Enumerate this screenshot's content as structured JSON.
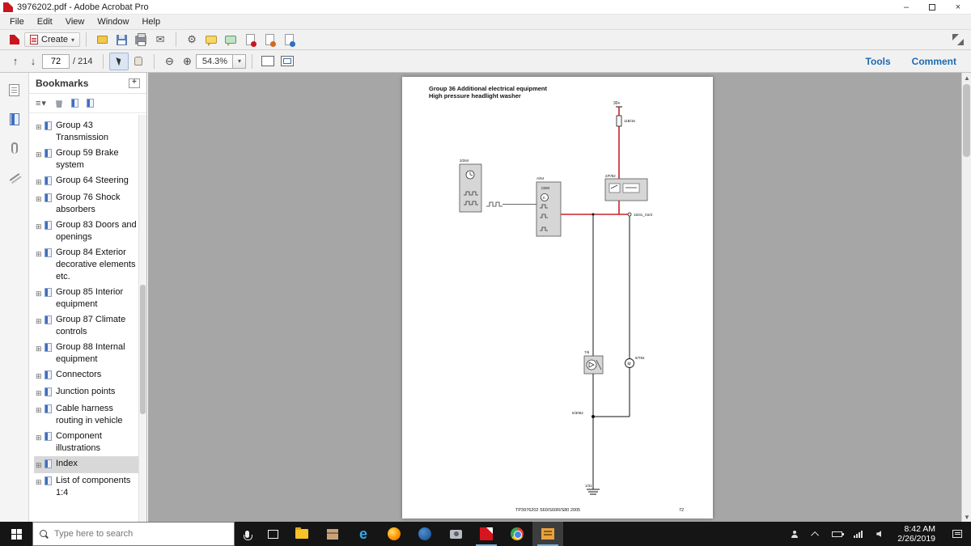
{
  "window": {
    "title": "3976202.pdf - Adobe Acrobat Pro"
  },
  "icons": {
    "minimize": "–",
    "close": "×",
    "caret": "▾",
    "mail": "✉",
    "gear": "⚙",
    "options": "≡▾",
    "nav_up": "↑",
    "nav_down": "↓",
    "zoom_out": "⊖",
    "zoom_in": "⊕",
    "expander": "⊞",
    "scroll_up": "▲",
    "scroll_down": "▼"
  },
  "menubar": {
    "items": [
      "File",
      "Edit",
      "View",
      "Window",
      "Help"
    ]
  },
  "toolbar": {
    "create_label": "Create"
  },
  "pagenav": {
    "page_current": "72",
    "page_total": "/ 214",
    "zoom_level": "54.3%",
    "tools_label": "Tools",
    "comment_label": "Comment"
  },
  "bookmarks": {
    "title": "Bookmarks",
    "items": [
      {
        "label": "Group 43 Transmission"
      },
      {
        "label": "Group 59 Brake system"
      },
      {
        "label": "Group 64 Steering"
      },
      {
        "label": "Group 76 Shock absorbers"
      },
      {
        "label": "Group 83 Doors and openings"
      },
      {
        "label": "Group 84 Exterior decorative elements etc."
      },
      {
        "label": "Group 85 Interior equipment"
      },
      {
        "label": "Group 87 Climate controls"
      },
      {
        "label": "Group 88 Internal equipment"
      },
      {
        "label": "Connectors"
      },
      {
        "label": "Junction points"
      },
      {
        "label": "Cable harness routing in vehicle"
      },
      {
        "label": "Component illustrations"
      },
      {
        "label": "Index"
      },
      {
        "label": "List of components 1:4"
      }
    ]
  },
  "document": {
    "heading_line1": "Group 36 Additional electrical equipment",
    "heading_line2": "High pressure headlight washer",
    "footer_doc": "TP3976202 S60/S60R/S80 2005",
    "footer_page": "72",
    "diagram": {
      "labels": {
        "power": "30+",
        "fuse": "11B/16",
        "comp_left": "3/264",
        "cem_top": "A/64",
        "cem": "CEM",
        "cem_k": "K",
        "relay": "2/F/82",
        "connector_mid": "15/31_C6/4",
        "pump": "7/6",
        "motor_label": "6/T84",
        "motor_m": "M",
        "junction": "5/3062",
        "ground": "1/31"
      }
    }
  },
  "taskbar": {
    "search_placeholder": "Type here to search",
    "time": "8:42 AM",
    "date": "2/26/2019"
  }
}
